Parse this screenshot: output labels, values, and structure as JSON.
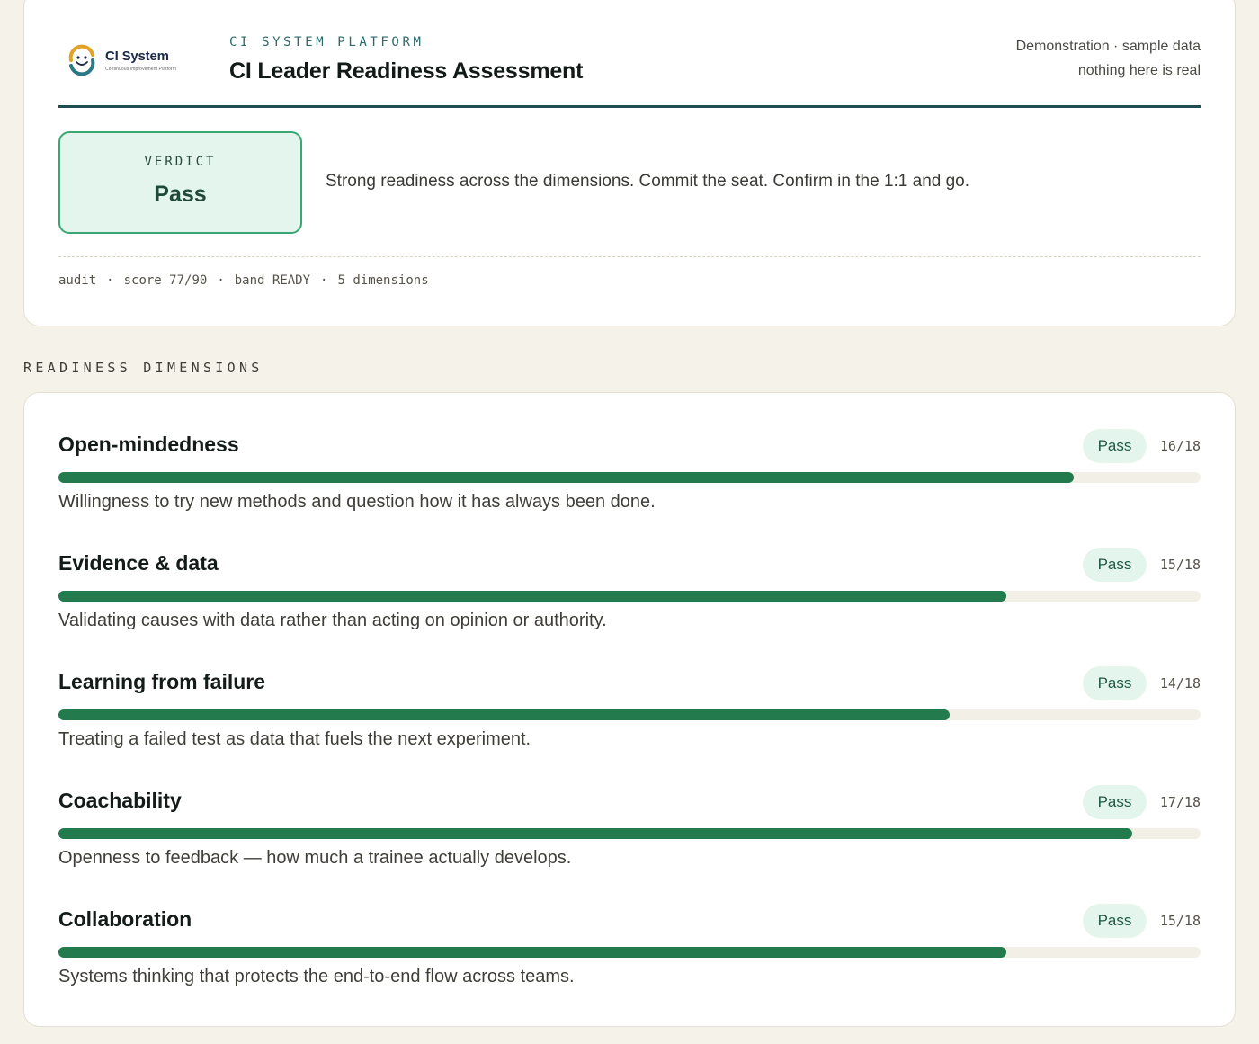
{
  "brand": {
    "name": "CI System",
    "tagline": "Continuous Improvement Platform"
  },
  "header": {
    "eyebrow": "CI SYSTEM PLATFORM",
    "title": "CI Leader Readiness Assessment",
    "note_line1": "Demonstration · sample data",
    "note_line2": "nothing here is real"
  },
  "verdict": {
    "label": "VERDICT",
    "value": "Pass",
    "summary": "Strong readiness across the dimensions. Commit the seat. Confirm in the 1:1 and go."
  },
  "audit": {
    "prefix": "audit",
    "score": "score 77/90",
    "band": "band READY",
    "dimensions": "5 dimensions",
    "separator": "·"
  },
  "section_label": "READINESS DIMENSIONS",
  "colors": {
    "accent": "#237a4d",
    "pass_bg": "#e3f5ec",
    "rule": "#1f4e52"
  },
  "dimensions": [
    {
      "name": "Open-mindedness",
      "status": "Pass",
      "score": "16/18",
      "fraction": 0.889,
      "description": "Willingness to try new methods and question how it has always been done."
    },
    {
      "name": "Evidence & data",
      "status": "Pass",
      "score": "15/18",
      "fraction": 0.83,
      "description": "Validating causes with data rather than acting on opinion or authority."
    },
    {
      "name": "Learning from failure",
      "status": "Pass",
      "score": "14/18",
      "fraction": 0.78,
      "description": "Treating a failed test as data that fuels the next experiment."
    },
    {
      "name": "Coachability",
      "status": "Pass",
      "score": "17/18",
      "fraction": 0.94,
      "description": "Openness to feedback — how much a trainee actually develops."
    },
    {
      "name": "Collaboration",
      "status": "Pass",
      "score": "15/18",
      "fraction": 0.83,
      "description": "Systems thinking that protects the end-to-end flow across teams."
    }
  ]
}
